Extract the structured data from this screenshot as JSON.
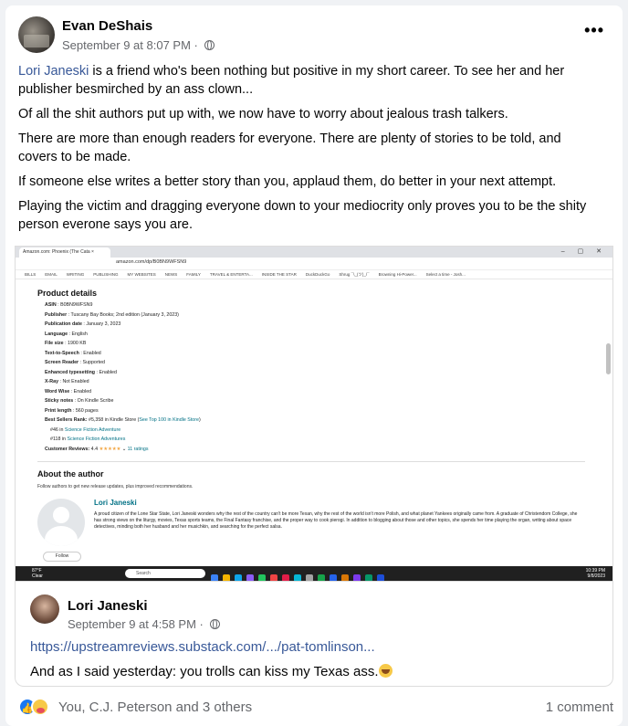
{
  "post": {
    "author": "Evan DeShais",
    "timestamp": "September 9 at 8:07 PM",
    "separator": "·",
    "more_icon": "•••",
    "mention": "Lori Janeski",
    "paragraph1_rest": " is a friend who's been nothing but positive in my short career. To see her and her publisher besmirched by an ass clown...",
    "paragraph2": "Of all the shit authors put up with, we now have to worry about jealous trash talkers.",
    "paragraph3": "There are more than enough readers for everyone. There are plenty of stories to be told, and covers to be made.",
    "paragraph4": "If someone else writes a better story than you, applaud them, do better in your next attempt.",
    "paragraph5": "Playing the victim and dragging everyone down to your mediocrity only proves you to be the shity person everone says you are."
  },
  "screenshot": {
    "tab_title": "Amazon.com: Phoenix (The Cata ×",
    "url": "amazon.com/dp/B0BN9WFSN9",
    "bookmarks": [
      "BILLS",
      "EMAIL",
      "WRITING",
      "PUBLISHING",
      "MY WEBSITES",
      "NEWS",
      "FAMILY",
      "TRAVEL & ENTERTA...",
      "INSIDE THE STAR",
      "DuckDuckGo",
      "Shrug ¯\\_(ツ)_/¯",
      "Browning Hi-Power...",
      "Select a time - Josh..."
    ],
    "product_details_title": "Product details",
    "details": [
      {
        "label": "ASIN",
        "value": "B0BN9WFSN9"
      },
      {
        "label": "Publisher",
        "value": "Tuscany Bay Books; 2nd edition (January 3, 2023)"
      },
      {
        "label": "Publication date",
        "value": "January 3, 2023"
      },
      {
        "label": "Language",
        "value": "English"
      },
      {
        "label": "File size",
        "value": "1900 KB"
      },
      {
        "label": "Text-to-Speech",
        "value": "Enabled"
      },
      {
        "label": "Screen Reader",
        "value": "Supported"
      },
      {
        "label": "Enhanced typesetting",
        "value": "Enabled"
      },
      {
        "label": "X-Ray",
        "value": "Not Enabled"
      },
      {
        "label": "Word Wise",
        "value": "Enabled"
      },
      {
        "label": "Sticky notes",
        "value": "On Kindle Scribe"
      },
      {
        "label": "Print length",
        "value": "560 pages"
      }
    ],
    "rank_label": "Best Sellers Rank:",
    "rank_value": "#5,358 in Kindle Store (",
    "rank_link": "See Top 100 in Kindle Store",
    "rank_close": ")",
    "rank_sub1_num": "#46 in ",
    "rank_sub1_cat": "Science Fiction Adventure",
    "rank_sub2_num": "#118 in ",
    "rank_sub2_cat": "Science Fiction Adventures",
    "reviews_label": "Customer Reviews:",
    "reviews_score": "4.4",
    "reviews_stars": "★★★★★",
    "reviews_count": "11 ratings",
    "about_title": "About the author",
    "follow_note": "Follow authors to get new release updates, plus improved recommendations.",
    "author_name": "Lori Janeski",
    "author_bio": "A proud citizen of the Lone Star State, Lori Janeski wonders why the rest of the country can't be more Texan, why the rest of the world isn't more Polish, and what planet Yankees originally came from. A graduate of Christendom College, she has strong views on the liturgy, movies, Texas sports teams, the Final Fantasy franchise, and the proper way to cook pierogi. In addition to blogging about those and other topics, she spends her time playing the organ, writing about space detectives, minding both her husband and her musichkin, and searching for the perfect salsa.",
    "follow_button": "Follow",
    "weather_temp": "87°F",
    "weather_desc": "Clear",
    "taskbar_search": "Search",
    "clock_time": "10:39 PM",
    "clock_date": "9/8/2023"
  },
  "shared": {
    "author": "Lori Janeski",
    "timestamp": "September 9 at 4:58 PM",
    "link": "https://upstreamreviews.substack.com/.../pat-tomlinson...",
    "text": "And as I said yesterday: you trolls can kiss my Texas ass."
  },
  "footer": {
    "reactions_text": "You, C.J. Peterson and 3 others",
    "comments": "1 comment",
    "like_icon_glyph": "👍"
  }
}
